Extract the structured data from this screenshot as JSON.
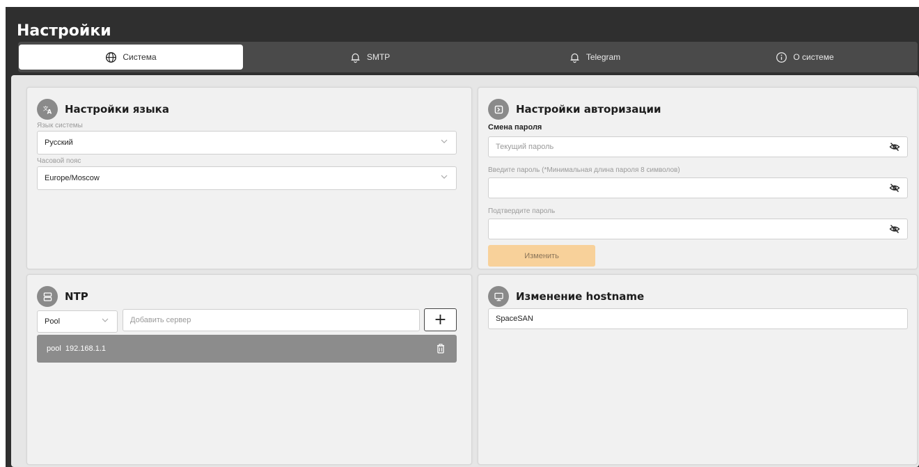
{
  "page": {
    "title": "Настройки"
  },
  "tabs": [
    {
      "label": "Система",
      "icon": "globe-icon",
      "active": true
    },
    {
      "label": "SMTP",
      "icon": "bell-icon",
      "active": false
    },
    {
      "label": "Telegram",
      "icon": "bell-icon",
      "active": false
    },
    {
      "label": "О системе",
      "icon": "info-icon",
      "active": false
    }
  ],
  "language": {
    "title": "Настройки языка",
    "icon": "translate-icon",
    "system_language_label": "Язык системы",
    "system_language_value": "Русский",
    "timezone_label": "Часовой пояс",
    "timezone_value": "Europe/Moscow"
  },
  "auth": {
    "title": "Настройки авторизации",
    "icon": "login-icon",
    "change_password_label": "Смена пароля",
    "current_password_placeholder": "Текущий пароль",
    "new_password_label": "Введите пароль (*Минимальная длина пароля 8 символов)",
    "confirm_password_label": "Подтвердите пароль",
    "change_button": "Изменить"
  },
  "ntp": {
    "title": "NTP",
    "icon": "server-icon",
    "type_value": "Pool",
    "server_placeholder": "Добавить сервер",
    "add_button": "+",
    "servers": [
      {
        "text": "pool  192.168.1.1"
      }
    ]
  },
  "hostname": {
    "title": "Изменение hostname",
    "icon": "monitor-icon",
    "value": "SpaceSAN"
  },
  "colors": {
    "header_bg": "#2f2f2f",
    "tabbar_bg": "#4a4a4a",
    "accent_button": "#f8d19a",
    "ntp_row_bg": "#8c8c8c"
  }
}
